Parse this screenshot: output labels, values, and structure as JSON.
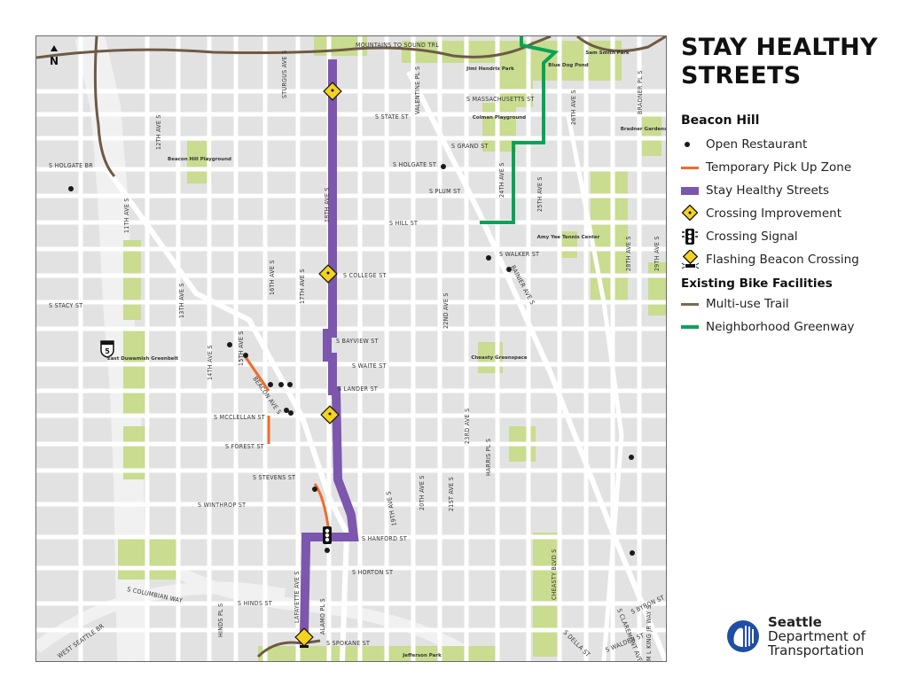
{
  "title": "STAY HEALTHY STREETS",
  "title_line1": "STAY HEALTHY",
  "title_line2": "STREETS",
  "neighborhood": "Beacon Hill",
  "legend": {
    "items": [
      {
        "label": "Open Restaurant",
        "symbol": "dot",
        "color": "#1a1a1a"
      },
      {
        "label": "Temporary Pick Up Zone",
        "symbol": "line",
        "color": "#f26a2a"
      },
      {
        "label": "Stay Healthy Streets",
        "symbol": "bar",
        "color": "#7c57ad"
      },
      {
        "label": "Crossing Improvement",
        "symbol": "diamond-sign",
        "color": "#f4d31e"
      },
      {
        "label": "Crossing Signal",
        "symbol": "traffic-signal",
        "color": "#111111"
      },
      {
        "label": "Flashing Beacon Crossing",
        "symbol": "flashing-beacon",
        "color": "#f4d31e"
      }
    ],
    "bike_section_title": "Existing Bike Facilities",
    "bike_items": [
      {
        "label": "Multi-use Trail",
        "symbol": "line",
        "color": "#7a6a55"
      },
      {
        "label": "Neighborhood Greenway",
        "symbol": "line",
        "color": "#0aa356"
      }
    ]
  },
  "logo": {
    "line1": "Seattle",
    "line2": "Department of",
    "line3": "Transportation",
    "color": "#1f4ea3"
  },
  "north_arrow": "N",
  "interstate_shield": "5",
  "colors": {
    "map_bg": "#e2e2e2",
    "road": "#ffffff",
    "park": "#c9dc8f",
    "stay_healthy": "#7c57ad",
    "greenway": "#0aa356",
    "trail": "#6e5a44",
    "pickup": "#f26a2a"
  },
  "map": {
    "street_labels": [
      "MOUNTAINS TO SOUND TRL",
      "STURGUS AVE S",
      "VALENTINE PL S",
      "S MASSACHUSETTS ST",
      "S STATE ST",
      "12TH AVE S",
      "S GRAND ST",
      "S HOLGATE BR",
      "S HOLGATE ST",
      "11TH AVE S",
      "18TH AVE S",
      "S PLUM ST",
      "24TH AVE S",
      "25TH AVE S",
      "26TH AVE S",
      "BRADNER PL S",
      "S HILL ST",
      "S WALKER ST",
      "28TH AVE S",
      "29TH AVE S",
      "16TH AVE S",
      "17TH AVE S",
      "S COLLEGE ST",
      "S STACY ST",
      "13TH AVE S",
      "22ND AVE S",
      "RAINIER AVE S",
      "S BAYVIEW ST",
      "14TH AVE S",
      "15TH AVE S",
      "S WAITE ST",
      "BEACON AVE S",
      "S LANDER ST",
      "S MCCLELLAN ST",
      "23RD AVE S",
      "S FOREST ST",
      "HARRIS PL S",
      "S STEVENS ST",
      "19TH AVE S",
      "20TH AVE S",
      "21ST AVE S",
      "S WINTHROP ST",
      "S HANFORD ST",
      "CHEASTY BLVD S",
      "S HORTON ST",
      "S COLUMBIAN WAY",
      "S HINDS ST",
      "HINDS PL S",
      "LAFAYETTE AVE S",
      "ALAMO PL S",
      "M L KING JR WAY S",
      "S BYRON ST",
      "S CLAREMONT AVE S",
      "WEST SEATTLE BR",
      "S SPOKANE ST",
      "S DELLA ST",
      "S WALDEN ST"
    ],
    "park_labels": [
      "Jimi Hendrix Park",
      "Sam Smith Park",
      "Blue Dog Pond",
      "Colman Playground",
      "Bradner Gardens Park",
      "Beacon Hill Playground",
      "Amy Yee Tennis Center",
      "East Duwamish Greenbelt",
      "Cheasty Greenspace",
      "Jefferson Park"
    ]
  }
}
